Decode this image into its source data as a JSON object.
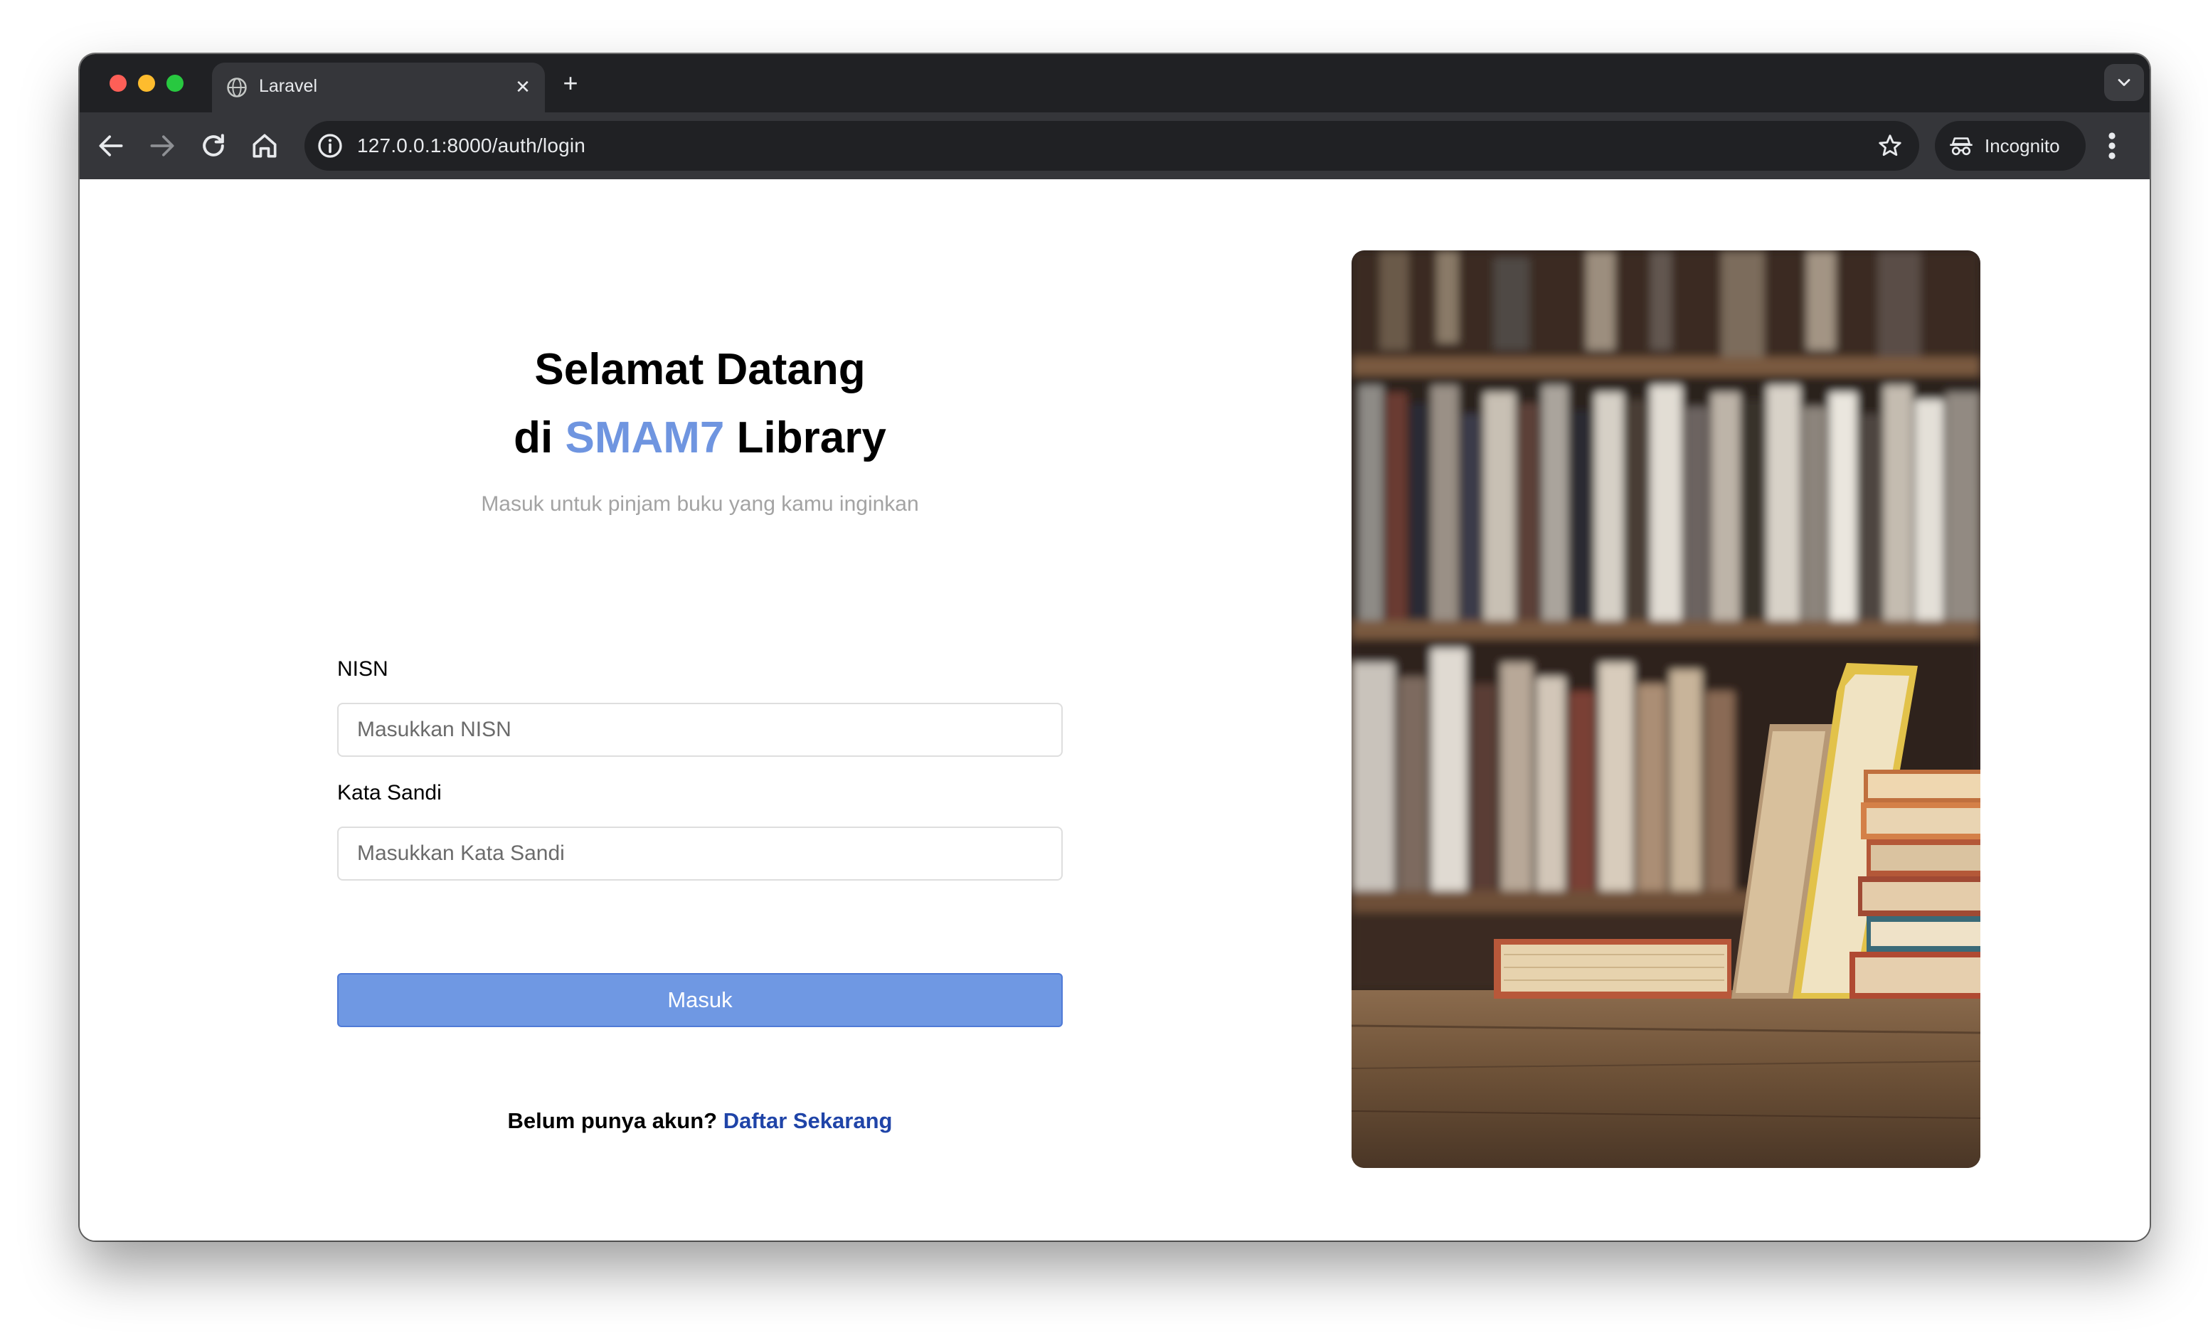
{
  "browser": {
    "tab_title": "Laravel",
    "url": "127.0.0.1:8000/auth/login",
    "incognito_label": "Incognito"
  },
  "login": {
    "heading_line1": "Selamat Datang",
    "heading_prefix": "di",
    "heading_brand": "SMAM7",
    "heading_suffix": "Library",
    "subtitle": "Masuk untuk pinjam buku yang kamu inginkan",
    "nisn_label": "NISN",
    "nisn_placeholder": "Masukkan NISN",
    "password_label": "Kata Sandi",
    "password_placeholder": "Masukkan Kata Sandi",
    "submit_label": "Masuk",
    "register_prompt": "Belum punya akun?",
    "register_link": "Daftar Sekarang"
  },
  "colors": {
    "accent": "#6f95e0",
    "button": "#6f98e3",
    "link": "#1f44a8"
  },
  "icons": [
    "globe-icon",
    "close-icon",
    "plus-icon",
    "chevron-down-icon",
    "back-icon",
    "forward-icon",
    "reload-icon",
    "home-icon",
    "info-icon",
    "star-icon",
    "incognito-icon",
    "more-vertical-icon"
  ]
}
